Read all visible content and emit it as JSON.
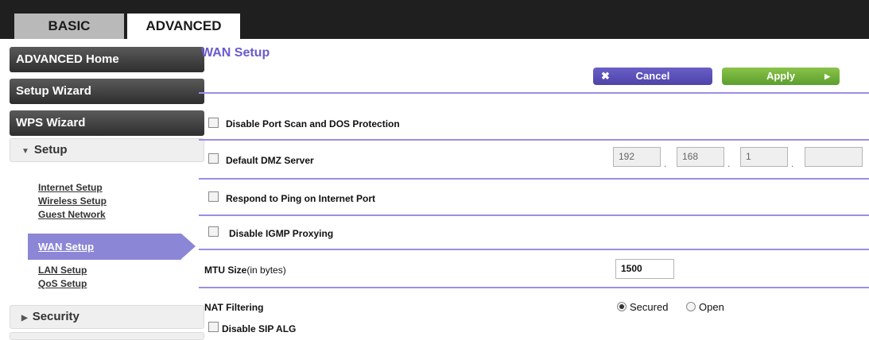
{
  "tabs": {
    "basic": "BASIC",
    "advanced": "ADVANCED"
  },
  "sidebar": {
    "buttons": [
      "ADVANCED Home",
      "Setup Wizard",
      "WPS Wizard"
    ],
    "setup_section": "Setup",
    "setup_links": [
      "Internet Setup",
      "Wireless Setup",
      "Guest Network",
      "WAN Setup",
      "LAN Setup",
      "QoS Setup"
    ],
    "security_section": "Security"
  },
  "page": {
    "title": "WAN Setup",
    "cancel_label": "Cancel",
    "apply_label": "Apply"
  },
  "options": {
    "port_scan": "Disable Port Scan and DOS Protection",
    "dmz": "Default DMZ Server",
    "ping": "Respond to Ping on Internet Port",
    "igmp": "Disable IGMP Proxying"
  },
  "dmz_ip": {
    "o1": "192",
    "o2": "168",
    "o3": "1",
    "o4": "",
    "sep": "."
  },
  "mtu": {
    "label": "MTU Size",
    "unit": "(in bytes)",
    "value": "1500"
  },
  "nat": {
    "label": "NAT Filtering",
    "secured": "Secured",
    "open": "Open",
    "selected": "Secured"
  },
  "sip": {
    "label": "Disable SIP ALG"
  },
  "colors": {
    "accent": "#6a5acd",
    "separator": "#9b8fe3",
    "apply": "#6fb33a",
    "cancel": "#5a50b8"
  }
}
